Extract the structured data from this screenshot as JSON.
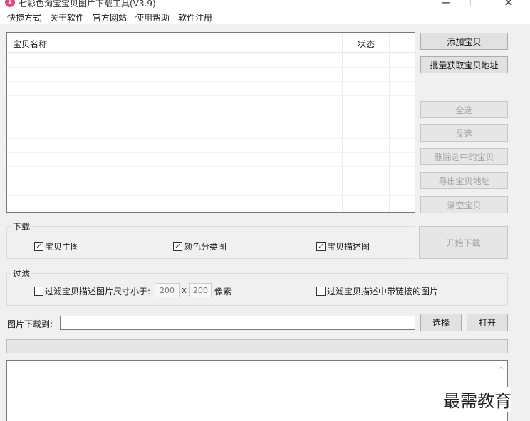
{
  "window": {
    "title": "七彩色淘宝宝贝图片下载工具(V3.9)",
    "minimize": "−",
    "maximize": "□",
    "close": "✕"
  },
  "menu": {
    "items": [
      "快捷方式",
      "关于软件",
      "官方网站",
      "使用帮助",
      "软件注册"
    ]
  },
  "list": {
    "columns": {
      "name": "宝贝名称",
      "status": "状态"
    }
  },
  "actions": {
    "add": "添加宝贝",
    "batch_get": "批量获取宝贝地址",
    "select_all": "全选",
    "invert": "反选",
    "delete_selected": "删除选中的宝贝",
    "export": "导出宝贝地址",
    "clear": "清空宝贝",
    "start_download": "开始下载"
  },
  "download_group": {
    "title": "下载",
    "main_image": {
      "label": "宝贝主图",
      "checked": true
    },
    "color_image": {
      "label": "颜色分类图",
      "checked": true
    },
    "desc_image": {
      "label": "宝贝描述图",
      "checked": true
    }
  },
  "filter_group": {
    "title": "过滤",
    "size_filter": {
      "label": "过滤宝贝描述图片尺寸小于:",
      "checked": false
    },
    "width": "200",
    "times": "x",
    "height": "200",
    "unit": "像素",
    "link_filter": {
      "label": "过滤宝贝描述中带链接的图片",
      "checked": false
    }
  },
  "save_path": {
    "label": "图片下载到:",
    "value": "",
    "choose": "选择",
    "open": "打开"
  },
  "progress": {
    "value": 0
  },
  "log": {
    "text": ""
  },
  "watermark": "最需教育",
  "colors": {
    "app_icon": "#e7457b",
    "window_bg": "#f0f0f0"
  },
  "icons": {
    "app": "app-logo-icon",
    "scroll": "scroll-up-arrow-icon"
  }
}
